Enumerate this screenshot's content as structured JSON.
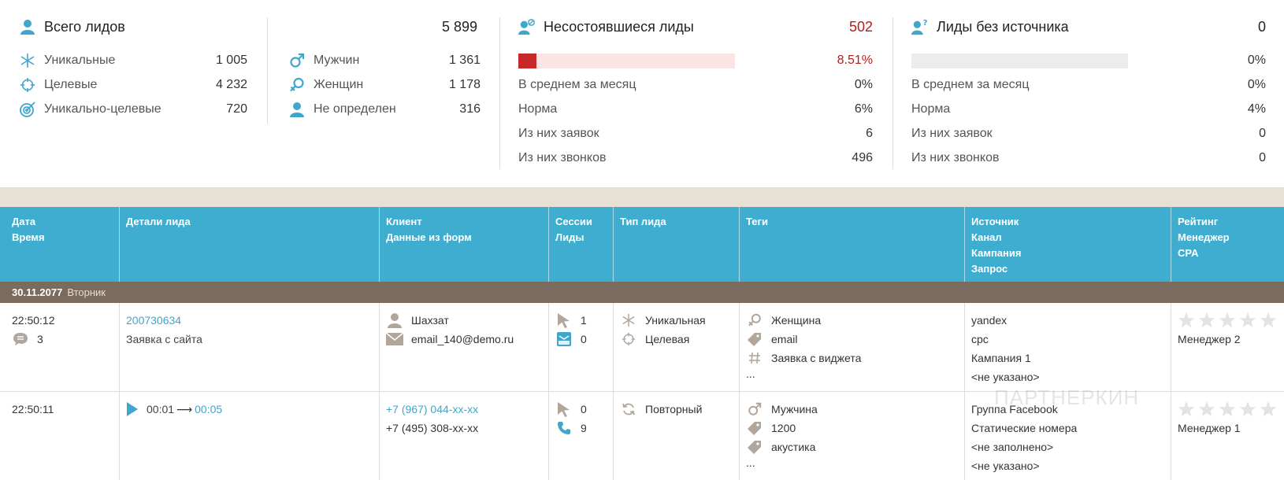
{
  "summary": {
    "total": {
      "title": "Всего лидов",
      "value": "5 899"
    },
    "left_metrics": [
      {
        "label": "Уникальные",
        "value": "1 005",
        "icon": "asterisk-icon"
      },
      {
        "label": "Целевые",
        "value": "4 232",
        "icon": "crosshair-icon"
      },
      {
        "label": "Уникально-целевые",
        "value": "720",
        "icon": "target-icon"
      }
    ],
    "gender_metrics": [
      {
        "label": "Мужчин",
        "value": "1 361",
        "icon": "male-icon"
      },
      {
        "label": "Женщин",
        "value": "1 178",
        "icon": "female-icon"
      },
      {
        "label": "Не определен",
        "value": "316",
        "icon": "person-icon"
      }
    ],
    "failed": {
      "title": "Несостоявшиеся лиды",
      "value": "502",
      "percent": "8.51%",
      "progress_fraction": 0.0851,
      "rows": [
        {
          "label": "В среднем за месяц",
          "value": "0%"
        },
        {
          "label": "Норма",
          "value": "6%"
        },
        {
          "label": "Из них заявок",
          "value": "6"
        },
        {
          "label": "Из них звонков",
          "value": "496"
        }
      ]
    },
    "no_source": {
      "title": "Лиды без источника",
      "value": "0",
      "percent": "0%",
      "progress_fraction": 0,
      "rows": [
        {
          "label": "В среднем за месяц",
          "value": "0%"
        },
        {
          "label": "Норма",
          "value": "4%"
        },
        {
          "label": "Из них заявок",
          "value": "0"
        },
        {
          "label": "Из них звонков",
          "value": "0"
        }
      ]
    }
  },
  "table": {
    "columns": [
      [
        "Дата",
        "Время"
      ],
      [
        "Детали лида"
      ],
      [
        "Клиент",
        "Данные из форм"
      ],
      [
        "Сессии",
        "Лиды"
      ],
      [
        "Тип лида"
      ],
      [
        "Теги"
      ],
      [
        "Источник",
        "Канал",
        "Кампания",
        "Запрос"
      ],
      [
        "Рейтинг",
        "Менеджер",
        "CPA"
      ]
    ],
    "date_group": {
      "date": "30.11.2077",
      "weekday": "Вторник"
    },
    "rows": [
      {
        "time": "22:50:12",
        "comments": "3",
        "lead_id": "200730634",
        "lead_desc": "Заявка с сайта",
        "client_name": "Шахзат",
        "client_email": "email_140@demo.ru",
        "sessions": "1",
        "leads": "0",
        "types": [
          "Уникальная",
          "Целевая"
        ],
        "tags": [
          "Женщина",
          "email",
          "Заявка с виджета"
        ],
        "tags_more": "...",
        "source": [
          "yandex",
          "cpc",
          "Кампания 1",
          "<не указано>"
        ],
        "manager": "Менеджер 2",
        "rating_stars": 0
      },
      {
        "time": "22:50:11",
        "call_time": "00:01",
        "call_arrow": "⟶",
        "call_duration": "00:05",
        "phone_1": "+7 (967) 044-xx-xx",
        "phone_2": "+7 (495) 308-xx-xx",
        "sessions": "0",
        "calls": "9",
        "types": [
          "Повторный"
        ],
        "tags": [
          "Мужчина",
          "1200",
          "акустика"
        ],
        "tags_more": "...",
        "source": [
          "Группа Facebook",
          "Статические номера",
          "<не заполнено>",
          "<не указано>"
        ],
        "manager": "Менеджер 1",
        "rating_stars": 0
      }
    ]
  },
  "watermark": "ПАРТНЕРКИН",
  "colors": {
    "accent": "#3fadcf",
    "header_icon": "#3fa6cc",
    "danger": "#c62828",
    "date_bar": "#7b6b5e",
    "beige": "#e7e0d5",
    "icon_gray": "#b0a69c"
  }
}
